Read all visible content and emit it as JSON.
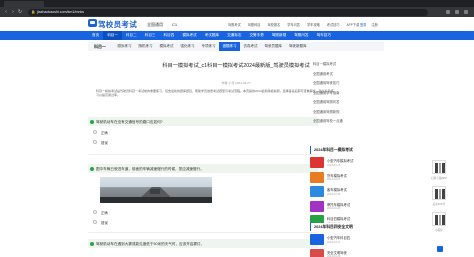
{
  "browser": {
    "url": "jiazhaokaoshi.com/km1/mnks"
  },
  "site": {
    "logo_text": "驾校员考试",
    "region": "全国通用",
    "license": "C1",
    "top_nav": [
      "驾照考试",
      "驾照科目",
      "驾校报名",
      "学车问答",
      "学车攻略",
      "考试技巧",
      "APP下载"
    ],
    "top_right": [
      "登录",
      "注册"
    ]
  },
  "main_nav": {
    "items": [
      "首页",
      "科目一",
      "科目二",
      "科目三",
      "科目四",
      "模拟考试",
      "考试题库",
      "交通标志",
      "交警手势",
      "驾照新规",
      "驾照问答",
      "驾车技巧"
    ],
    "active_index": 1
  },
  "sub_nav": {
    "title": "科目一",
    "items": [
      "顺序练习",
      "随机练习",
      "模拟考试",
      "强化练习",
      "专项练习",
      "错题练习",
      "仿真考试",
      "驾驶员题库",
      "驾驶新题库"
    ],
    "active_index": 5
  },
  "article": {
    "title": "科目一模拟考试_c1科目一模拟考试2024最新版_驾驶员模拟考试",
    "meta": "作者:小驾  2024-03-27",
    "intro": "科目一模拟考试是驾驶员科目一考试前的重要练习，包含最新的题库题目，帮助学员熟悉考试题型与考试流程。本页提供2024最新版模拟题，选择答案后即可查看解析，建议反复练习以提高通过率。"
  },
  "questions": [
    {
      "text": "驾驶机动车在没有交通信号的路口应如何?",
      "options": [
        "正确",
        "错误"
      ],
      "has_image": false
    },
    {
      "text": "图中车辆已驶进车道，前面的车辆减速慢行的时候，您应减速慢行。",
      "options": [
        "正确",
        "错误"
      ],
      "has_image": true
    },
    {
      "text": "驾驶机动车在遇到大雾或能见度低于50米的天气时，应该开启雾灯。",
      "options": [],
      "has_image": false
    }
  ],
  "sidebar": {
    "links": [
      "科目一模拟考试",
      "全国通用考试",
      "全国通用驾驶技巧",
      "全国通用学车指南",
      "全国通用驾照问答",
      "全国通用驾照新规",
      "全国通用驾校一点通"
    ],
    "section1_title": "2024年科目一模拟考试",
    "section1_items": [
      {
        "title": "小型汽车模拟考试",
        "meta": "2024-03-26"
      },
      {
        "title": "货车模拟考试",
        "meta": "2024-03-25"
      },
      {
        "title": "客车模拟考试",
        "meta": "2024-03-24"
      },
      {
        "title": "摩托车模拟考试",
        "meta": "2024-03-23"
      },
      {
        "title": "科目四模拟考试",
        "meta": "2024-03-22"
      }
    ],
    "section2_title": "2024年科目四安全文明",
    "section2_items": [
      {
        "title": "小型汽车科目四",
        "meta": "2024-03-21"
      },
      {
        "title": "安全文明驾驶",
        "meta": "2024-03-20"
      }
    ],
    "qr_labels": [
      "扫码下载APP",
      "关注公众号",
      "小程序"
    ],
    "thumb_colors": [
      "#d33",
      "#e77c22",
      "#2a8be0",
      "#a033c4",
      "#27a047",
      "#1763e0",
      "#d94b4b"
    ]
  },
  "colors": {
    "brand": "#1763e0",
    "question_bg": "#eef5ee",
    "accent": "#2aa34a"
  }
}
